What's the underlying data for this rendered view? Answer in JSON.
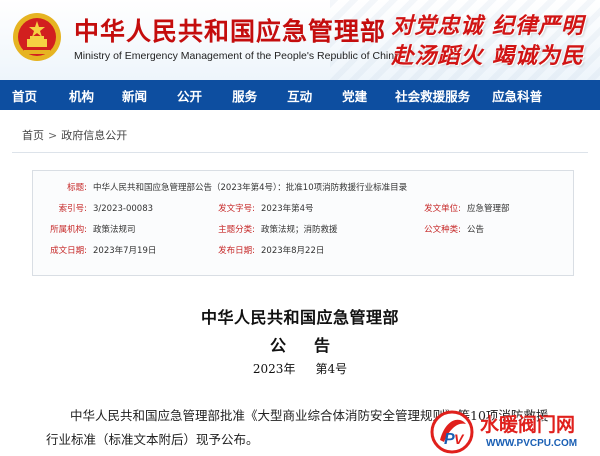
{
  "header": {
    "title": "中华人民共和国应急管理部",
    "subtitle": "Ministry of Emergency Management of the People's Republic of China",
    "slogan_line1": "对党忠诚 纪律严明",
    "slogan_line2": "赴汤蹈火 竭诚为民"
  },
  "nav": {
    "items": [
      "首页",
      "机构",
      "新闻",
      "公开",
      "服务",
      "互动",
      "党建",
      "社会救援服务",
      "应急科普"
    ]
  },
  "breadcrumb": {
    "home": "首页",
    "current": "政府信息公开"
  },
  "info": {
    "title_label": "标题:",
    "title_value": "中华人民共和国应急管理部公告（2023年第4号）：批准10项消防救援行业标准目录",
    "index_label": "索引号:",
    "index_value": "3/2023-00083",
    "docno_label": "发文字号:",
    "docno_value": "2023年第4号",
    "unit_label": "发文单位:",
    "unit_value": "应急管理部",
    "category_label": "所属机构:",
    "category_value": "政策法规司",
    "topic_label": "主题分类:",
    "topic_value": "政策法规；消防救援",
    "type_label": "公文种类:",
    "type_value": "公告",
    "date_label": "成文日期:",
    "date_value": "2023年7月19日",
    "publish_label": "发布日期:",
    "publish_value": "2023年8月22日"
  },
  "document": {
    "heading": "中华人民共和国应急管理部",
    "gong": "公",
    "gao": "告",
    "year": "2023年",
    "number": "第4号",
    "body": "中华人民共和国应急管理部批准《大型商业综合体消防安全管理规则》等10项消防救援行业标准（标准文本附后）现予公布。"
  },
  "watermark": {
    "cn": "水暖阀门网",
    "url": "WWW.PVCPU.COM"
  },
  "colors": {
    "nav_bg": "#0d4ea0",
    "title_red": "#c40d0d",
    "label_red": "#c62828"
  }
}
